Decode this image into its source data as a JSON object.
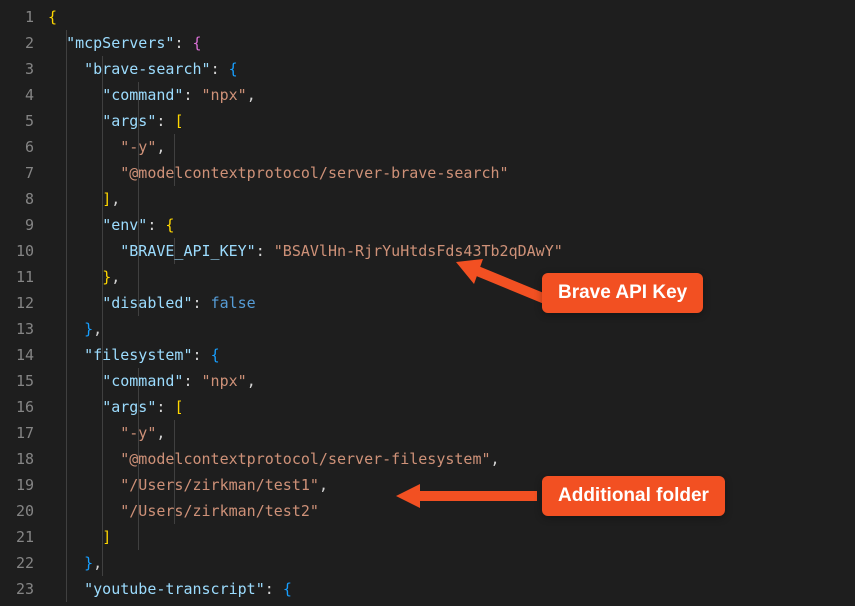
{
  "lines": [
    {
      "n": "1"
    },
    {
      "n": "2"
    },
    {
      "n": "3"
    },
    {
      "n": "4"
    },
    {
      "n": "5"
    },
    {
      "n": "6"
    },
    {
      "n": "7"
    },
    {
      "n": "8"
    },
    {
      "n": "9"
    },
    {
      "n": "10"
    },
    {
      "n": "11"
    },
    {
      "n": "12"
    },
    {
      "n": "13"
    },
    {
      "n": "14"
    },
    {
      "n": "15"
    },
    {
      "n": "16"
    },
    {
      "n": "17"
    },
    {
      "n": "18"
    },
    {
      "n": "19"
    },
    {
      "n": "20"
    },
    {
      "n": "21"
    },
    {
      "n": "22"
    },
    {
      "n": "23"
    }
  ],
  "tokens": {
    "brace_open": "{",
    "brace_close": "}",
    "bracket_open": "[",
    "bracket_close": "]",
    "comma": ",",
    "colon": ":"
  },
  "json": {
    "k_mcpServers": "\"mcpServers\"",
    "k_braveSearch": "\"brave-search\"",
    "k_command": "\"command\"",
    "v_npx": "\"npx\"",
    "k_args": "\"args\"",
    "v_y": "\"-y\"",
    "v_braveServer": "\"@modelcontextprotocol/server-brave-search\"",
    "k_env": "\"env\"",
    "k_braveApiKey": "\"BRAVE_API_KEY\"",
    "v_braveApiKey": "\"BSAVlHn-RjrYuHtdsFds43Tb2qDAwY\"",
    "k_disabled": "\"disabled\"",
    "v_false": "false",
    "k_filesystem": "\"filesystem\"",
    "v_fsServer": "\"@modelcontextprotocol/server-filesystem\"",
    "v_path1": "\"/Users/zirkman/test1\"",
    "v_path2": "\"/Users/zirkman/test2\"",
    "k_youtube": "\"youtube-transcript\""
  },
  "annotations": {
    "braveApiKey": "Brave API Key",
    "additionalFolder": "Additional folder"
  }
}
